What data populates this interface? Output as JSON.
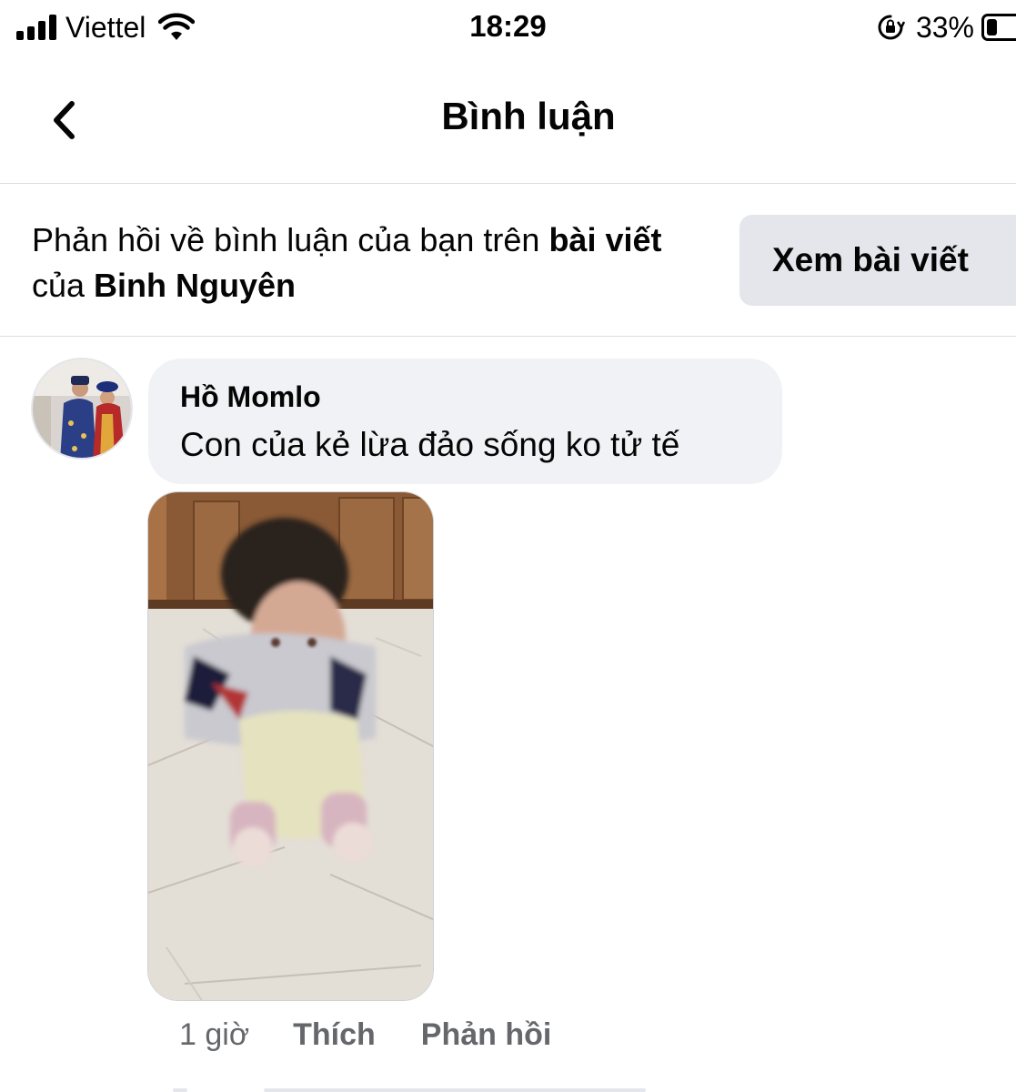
{
  "status_bar": {
    "carrier": "Viettel",
    "time": "18:29",
    "battery_percent": "33%",
    "battery_level": 0.33,
    "icons": [
      "signal-icon",
      "wifi-icon",
      "rotation-lock-icon",
      "battery-icon"
    ]
  },
  "header": {
    "title": "Bình luận",
    "back_icon": "chevron-left-icon"
  },
  "notice": {
    "text_prefix": "Phản hồi về bình luận của bạn trên ",
    "text_bold_1": "bài viết",
    "text_middle": " của ",
    "text_bold_2": "Binh Nguyên",
    "button_label": "Xem bài viết"
  },
  "comment": {
    "author": "Hồ Momlo",
    "text": "Con của kẻ lừa đảo sống ko tử tế",
    "time_ago": "1 giờ",
    "like_label": "Thích",
    "reply_label": "Phản hồi"
  },
  "colors": {
    "text_primary": "#050505",
    "text_secondary": "#65676b",
    "bubble_bg": "#f0f2f5",
    "button_bg": "#e4e6eb",
    "divider": "#dcdde0"
  }
}
